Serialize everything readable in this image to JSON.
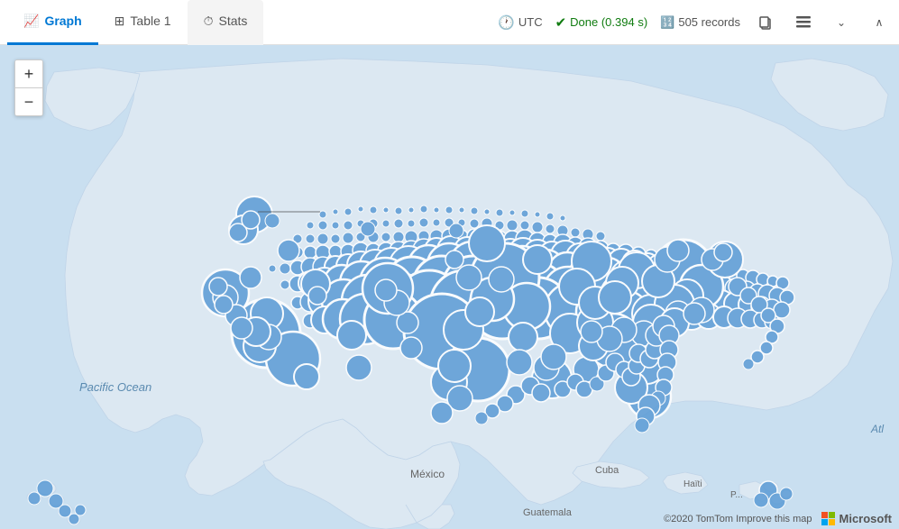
{
  "header": {
    "tabs": [
      {
        "id": "graph",
        "label": "Graph",
        "icon": "📈",
        "active": true
      },
      {
        "id": "table",
        "label": "Table 1",
        "icon": "⊞",
        "active": false
      },
      {
        "id": "stats",
        "label": "Stats",
        "icon": "⏱",
        "active": false
      }
    ],
    "utc_label": "UTC",
    "done_label": "Done (0.394 s)",
    "records_label": "505 records",
    "chevron_down": "⌄",
    "collapse": "∧"
  },
  "map": {
    "zoom_in": "+",
    "zoom_out": "−",
    "pacific_ocean": "Pacific Ocean",
    "atlantic_ocean": "Atl",
    "attribution": "©2020 TomTom  Improve this map",
    "mexico_label": "México",
    "cuba_label": "Cuba",
    "haiti_label": "Haïti",
    "guatemala_label": "Guatemala"
  },
  "colors": {
    "active_tab": "#0078d4",
    "map_ocean": "#c9dff0",
    "map_land": "#e8eef4",
    "bubble_fill": "#5b9bd5",
    "bubble_stroke": "#fff",
    "done_green": "#107c10",
    "ms_red": "#f25022",
    "ms_green": "#7fba00",
    "ms_blue": "#00a4ef",
    "ms_yellow": "#ffb900"
  }
}
